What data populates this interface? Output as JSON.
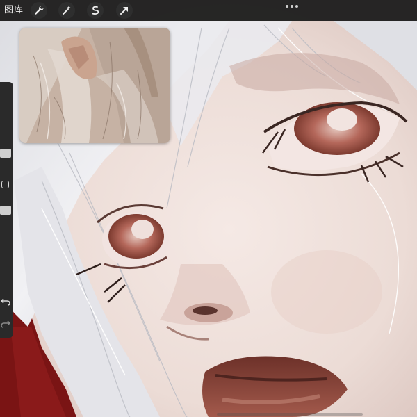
{
  "topbar": {
    "gallery_label": "图库",
    "tools": [
      {
        "icon": "wrench-icon"
      },
      {
        "icon": "magic-wand-icon"
      },
      {
        "icon": "selection-s-icon"
      },
      {
        "icon": "transform-arrow-icon"
      }
    ],
    "more_icon": "more-dots-icon"
  },
  "sidebar": {
    "top_slider_icon": "brush-size-slider",
    "modifier_icon": "modifier-square-icon",
    "bottom_slider_icon": "opacity-slider",
    "undo_icon": "undo-icon",
    "redo_icon": "redo-icon"
  },
  "reference_window": {
    "icon": "reference-image"
  },
  "colors": {
    "toolbar": "#1e1e1e",
    "skin": "#efe1dc",
    "hair": "#e9e9ec",
    "eye_red": "#9c4a3a",
    "lip": "#7e3f34",
    "dark_red_bg": "#7a1414"
  }
}
